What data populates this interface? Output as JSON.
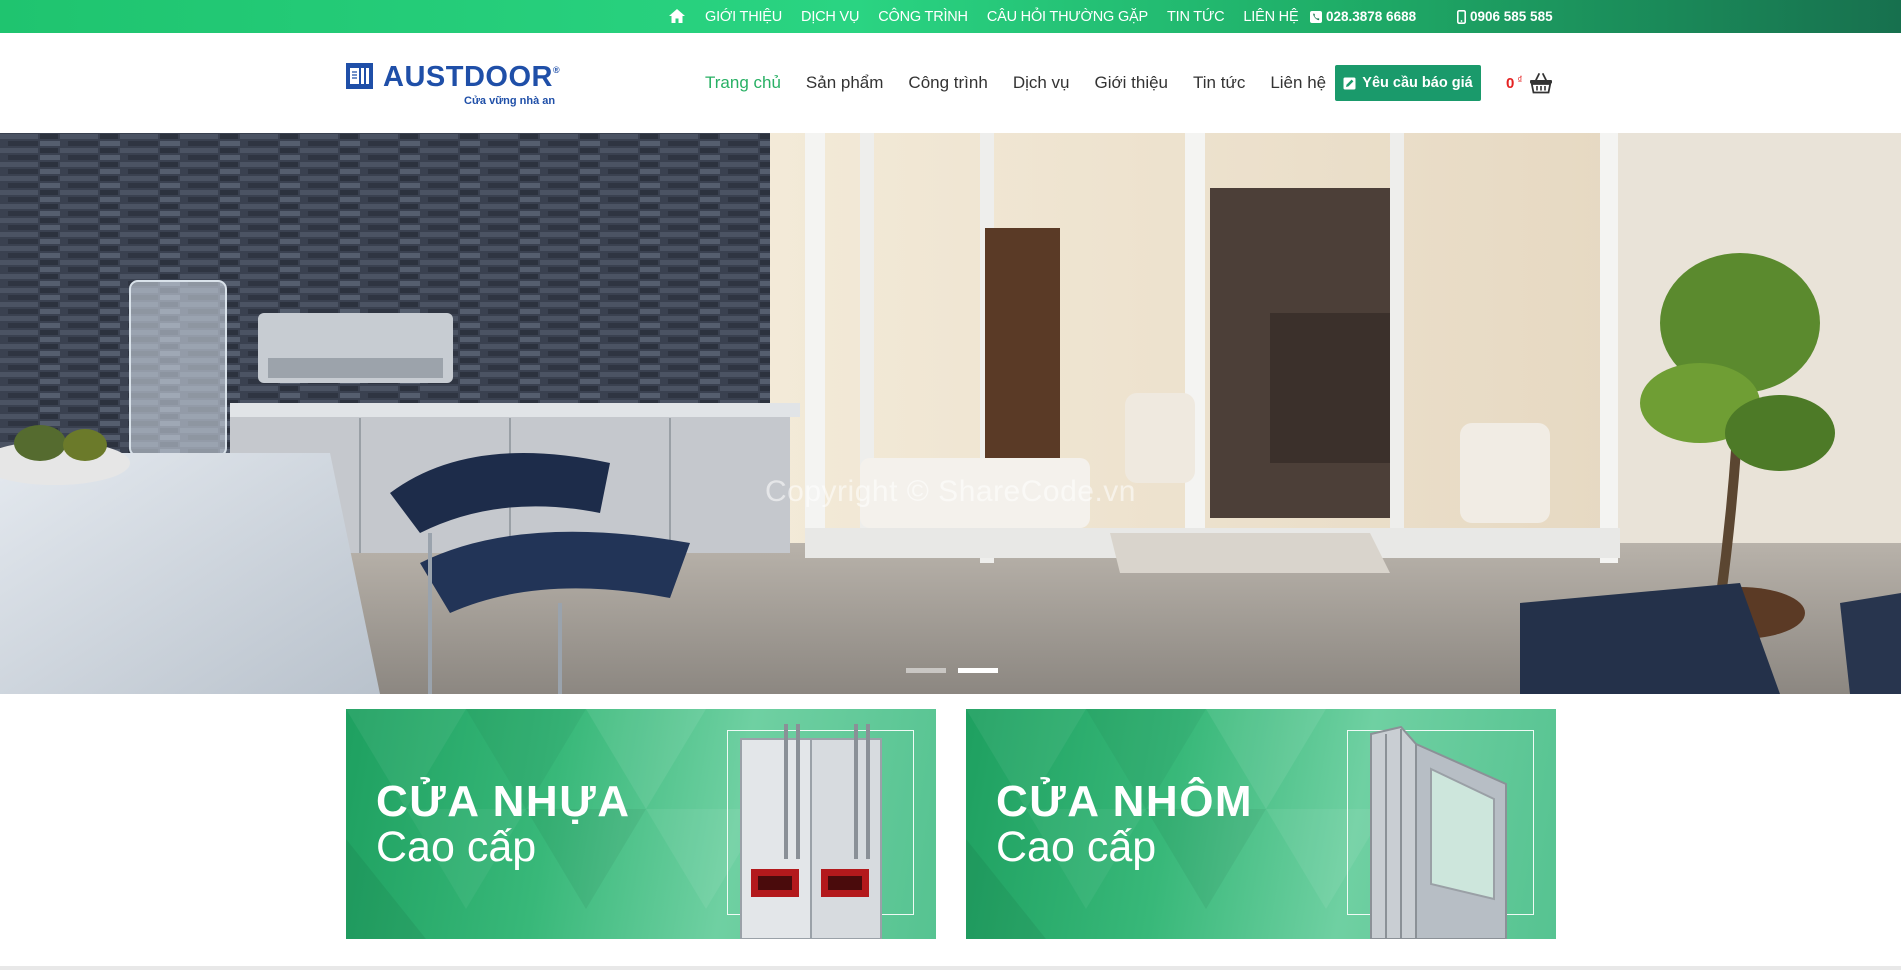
{
  "topbar": {
    "home_icon": "home-icon",
    "links": [
      "GIỚI THIỆU",
      "DỊCH VỤ",
      "CÔNG TRÌNH",
      "CÂU HỎI THƯỜNG GẶP",
      "TIN TỨC",
      "LIÊN HỆ"
    ],
    "phone_landline": "028.3878 6688",
    "phone_mobile": "0906 585 585",
    "landline_icon": "phone-square-icon",
    "mobile_icon": "mobile-phone-icon"
  },
  "header": {
    "logo_brand": "AUSTDOOR",
    "logo_registered": "®",
    "logo_tagline": "Cửa vững nhà an",
    "nav": [
      "Trang chủ",
      "Sản phẩm",
      "Công trình",
      "Dịch vụ",
      "Giới thiệu",
      "Tin tức",
      "Liên hệ"
    ],
    "active_nav": "Trang chủ",
    "quote_button": "Yêu cầu báo giá",
    "quote_icon": "edit-icon",
    "cart_amount": "0",
    "cart_currency": "₫",
    "cart_icon": "shopping-basket-icon"
  },
  "hero": {
    "watermark": "Copyright © ShareCode.vn",
    "slides_total": 2,
    "active_slide": 2
  },
  "banners": [
    {
      "title": "CỬA NHỰA",
      "subtitle": "Cao cấp"
    },
    {
      "title": "CỬA NHÔM",
      "subtitle": "Cao cấp"
    }
  ],
  "colors": {
    "brand_green": "#1a9a6b",
    "active_nav": "#28b064",
    "logo_blue": "#1f4fa8",
    "cart_red": "#e52222"
  }
}
